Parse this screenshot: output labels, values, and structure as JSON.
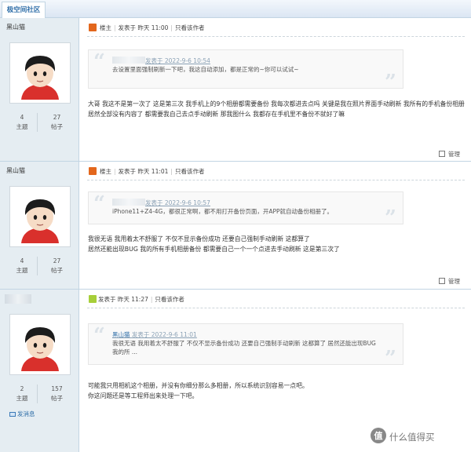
{
  "forum": {
    "tab_label": "极空间社区"
  },
  "posts": [
    {
      "author": "黑山猫",
      "author_blurred": false,
      "stats": {
        "threads": "4",
        "threads_label": "主题",
        "posts": "27",
        "posts_label": "帖子"
      },
      "meta": {
        "host_label": "楼主",
        "posted": "发表于 昨天 11:00",
        "author_only": "只看该作者"
      },
      "quote": {
        "head_prefix": "",
        "head": "发表于 2022-9-6 10:54",
        "text": "去设置里面强制刷新一下吧，我这自动添加，都是正常的~你可以试试~"
      },
      "body": [
        "大哥 我这不是第一次了 这是第三次 我手机上的9个相册都需要备份 我每次都进去点吗 关键是我在照片界面手动刷新 我所有的手机备份相册居然全部没有内容了 都需要我自己去点手动刷新 那我图什么 我都存在手机里不备份不就好了嘛"
      ],
      "manage_label": "管理"
    },
    {
      "author": "黑山猫",
      "author_blurred": false,
      "stats": {
        "threads": "4",
        "threads_label": "主题",
        "posts": "27",
        "posts_label": "帖子"
      },
      "meta": {
        "host_label": "楼主",
        "posted": "发表于 昨天 11:01",
        "author_only": "只看该作者"
      },
      "quote": {
        "head_prefix": "",
        "head": "发表于 2022-9-6 10:57",
        "text": "iPhone11+Z4-4G，都很正常啊，都不用打开备份页面，开APP就自动备份相册了。"
      },
      "body": [
        "我很无语 我用着太不舒服了 不仅不显示备份成功 还要自己强制手动刷新 这都算了",
        "居然还能出现BUG 我的所有手机相册备份 都需要自己一个一个点进去手动刷新 这是第三次了"
      ],
      "manage_label": "管理"
    },
    {
      "author": "",
      "author_blurred": true,
      "stats": {
        "threads": "2",
        "threads_label": "主题",
        "posts": "157",
        "posts_label": "帖子"
      },
      "send_message": "发消息",
      "meta": {
        "posted": "发表于 昨天 11:27",
        "author_only": "只看该作者"
      },
      "quote": {
        "head_prefix": "黑山猫",
        "head": "发表于 2022-9-6 11:01",
        "text": "我很无语 我用着太不舒服了 不仅不显示备份成功 还要自己强制手动刷新 这都算了 居然还能出现BUG 我的所 ..."
      },
      "body": [
        "可能我只用相机这个相册，并没有你细分那么多相册，所以系统识别容易一点吧。",
        "你这问题还是等工程师出来处理一下吧。"
      ]
    }
  ],
  "watermark": {
    "text": "什么值得买"
  },
  "colors": {
    "link": "#2f6ea8",
    "sidebar_bg": "#e5edf2",
    "border": "#c2d5e3",
    "host_icon": "#e3671d"
  }
}
